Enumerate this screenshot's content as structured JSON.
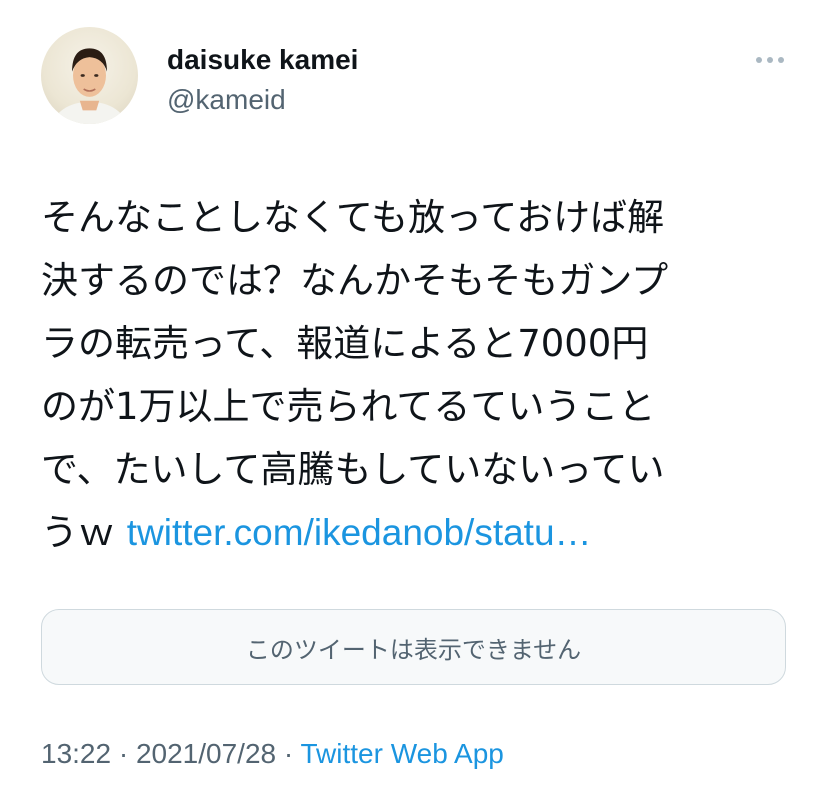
{
  "tweet": {
    "author": {
      "display_name": "daisuke kamei",
      "handle": "@kameid",
      "avatar_icon": "user-avatar-photo"
    },
    "more_icon": "more-horizontal-icon",
    "text_lines": [
      "そんなことしなくても放っておけば解",
      "決するのでは？なんかそもそもガンプ",
      "ラの転売って、報道によると7000円",
      "のが1万以上で売られてるていうこと",
      "で、たいして高騰もしていないってい"
    ],
    "last_line_prefix": "うｗ ",
    "link_text": "twitter.com/ikedanob/statu…",
    "quote_unavailable": "このツイートは表示できません",
    "time": "13:22",
    "date": "2021/07/28",
    "separator": " · ",
    "source": "Twitter Web App"
  },
  "colors": {
    "text": "#0f1419",
    "secondary": "#536471",
    "link": "#1b95e0",
    "border": "#cfd9de",
    "card_bg": "#f7f9fa"
  }
}
